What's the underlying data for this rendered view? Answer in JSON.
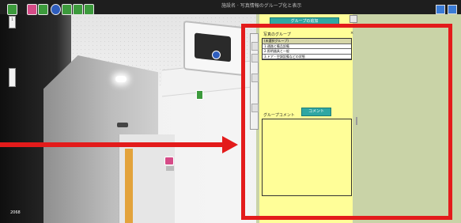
{
  "topbar": {
    "title": "施設名 · 写真情報のグループ化と表示",
    "left_icons": [
      "document-green-icon",
      "comment-pink-icon",
      "document-green-icon",
      "hotspot-blue-icon",
      "document-green-icon",
      "document-green-icon",
      "document-green-icon"
    ],
    "right_icons": [
      "settings-icon",
      "window-icon"
    ]
  },
  "panorama": {
    "frame_label": "2068",
    "left_strip_label": "1"
  },
  "side_panel": {
    "add_group_button": "グループの追加",
    "group_section_label": "写真のグループ",
    "groups": [
      {
        "label": "(未選択グループ)",
        "selected": true
      },
      {
        "label": "1.通路と備品設備",
        "selected": false
      },
      {
        "label": "2.照明器具と一般",
        "selected": false
      },
      {
        "label": "3.ドア・空調設備などの状態",
        "selected": false
      }
    ],
    "close_label": "×",
    "comment_section_label": "グループコメント",
    "comment_button": "コメント",
    "comment_text": ""
  },
  "colors": {
    "highlight": "#e31b1b",
    "panel_yellow": "#fffe98",
    "panel_bg": "#c9d3a7",
    "teal_button": "#2fa7a3"
  }
}
